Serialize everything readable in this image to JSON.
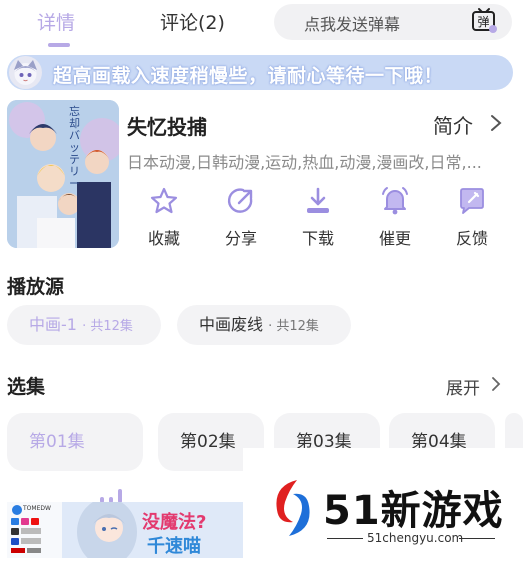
{
  "tabs": {
    "detail": "详情",
    "comment": "评论(2)"
  },
  "danmu": {
    "placeholder": "点我发送弹幕",
    "icon_label": "弹"
  },
  "notice": {
    "text": "超高画载入速度稍慢些，请耐心等待一下哦！"
  },
  "anime": {
    "title": "失忆投捕",
    "intro_label": "简介",
    "tags": "日本动漫,日韩动漫,运动,热血,动漫,漫画改,日常,...",
    "cover_text": "忘却バッテリー"
  },
  "actions": [
    {
      "label": "收藏",
      "icon": "star-icon"
    },
    {
      "label": "分享",
      "icon": "share-icon"
    },
    {
      "label": "下载",
      "icon": "download-icon"
    },
    {
      "label": "催更",
      "icon": "bell-icon"
    },
    {
      "label": "反馈",
      "icon": "feedback-icon"
    }
  ],
  "sources": {
    "title": "播放源",
    "items": [
      {
        "name": "中画-1",
        "count": "· 共12集",
        "active": true
      },
      {
        "name": "中画废线",
        "count": "· 共12集",
        "active": false
      }
    ]
  },
  "episodes": {
    "title": "选集",
    "expand_label": "展开",
    "items": [
      "第01集",
      "第02集",
      "第03集",
      "第04集"
    ],
    "active_index": 0
  },
  "ad": {
    "line1": "没魔法?",
    "line2": "千速喵",
    "brand": "TOMEDW"
  },
  "watermark": {
    "name": "51新游戏",
    "url": "51chengyu.com"
  },
  "colors": {
    "accent": "#b7a9e6",
    "notice_bg": "#c9d9f5",
    "chip_bg": "#f3f3f5"
  }
}
